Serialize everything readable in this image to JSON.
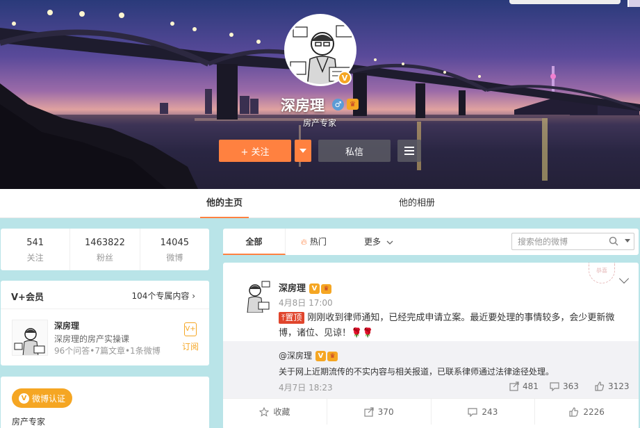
{
  "profile": {
    "name": "深房理",
    "title": "房产专家",
    "verified_badge": "V",
    "follow_label": "+ 关注",
    "message_label": "私信"
  },
  "tabs": {
    "home": "他的主页",
    "album": "他的相册"
  },
  "stats": [
    {
      "value": "541",
      "label": "关注"
    },
    {
      "value": "1463822",
      "label": "粉丝"
    },
    {
      "value": "14045",
      "label": "微博"
    }
  ],
  "vplus": {
    "heading": "V+会员",
    "link": "104个专属内容",
    "name": "深房理",
    "desc": "深房理的房产实操课",
    "meta": "96个问答•7篇文章•1条微博",
    "subscribe": "订阅",
    "sub_icon": "V+"
  },
  "verify": {
    "button": "微博认证",
    "text": "房产专家"
  },
  "filter": {
    "all": "全部",
    "hot": "热门",
    "more": "更多",
    "search_placeholder": "搜索他的微博"
  },
  "post": {
    "author": "深房理",
    "time": "4月8日 17:00",
    "pin_label": "置顶",
    "text": "刚刚收到律师通知，已经完成申请立案。最近要处理的事情较多，会少更新微博，诸位、见谅！",
    "emoji": "🌹🌹",
    "repost": {
      "author": "@深房理",
      "text": "关于网上近期流传的不实内容与相关报道，已联系律师通过法律途径处理。",
      "time": "4月7日 18:23",
      "reposts": "481",
      "comments": "363",
      "likes": "3123"
    },
    "actions": {
      "favorite": "收藏",
      "reposts": "370",
      "comments": "243",
      "likes": "2226"
    }
  },
  "colors": {
    "accent": "#ff8140",
    "gold": "#f5a623",
    "page_bg": "#b9e4e8"
  }
}
